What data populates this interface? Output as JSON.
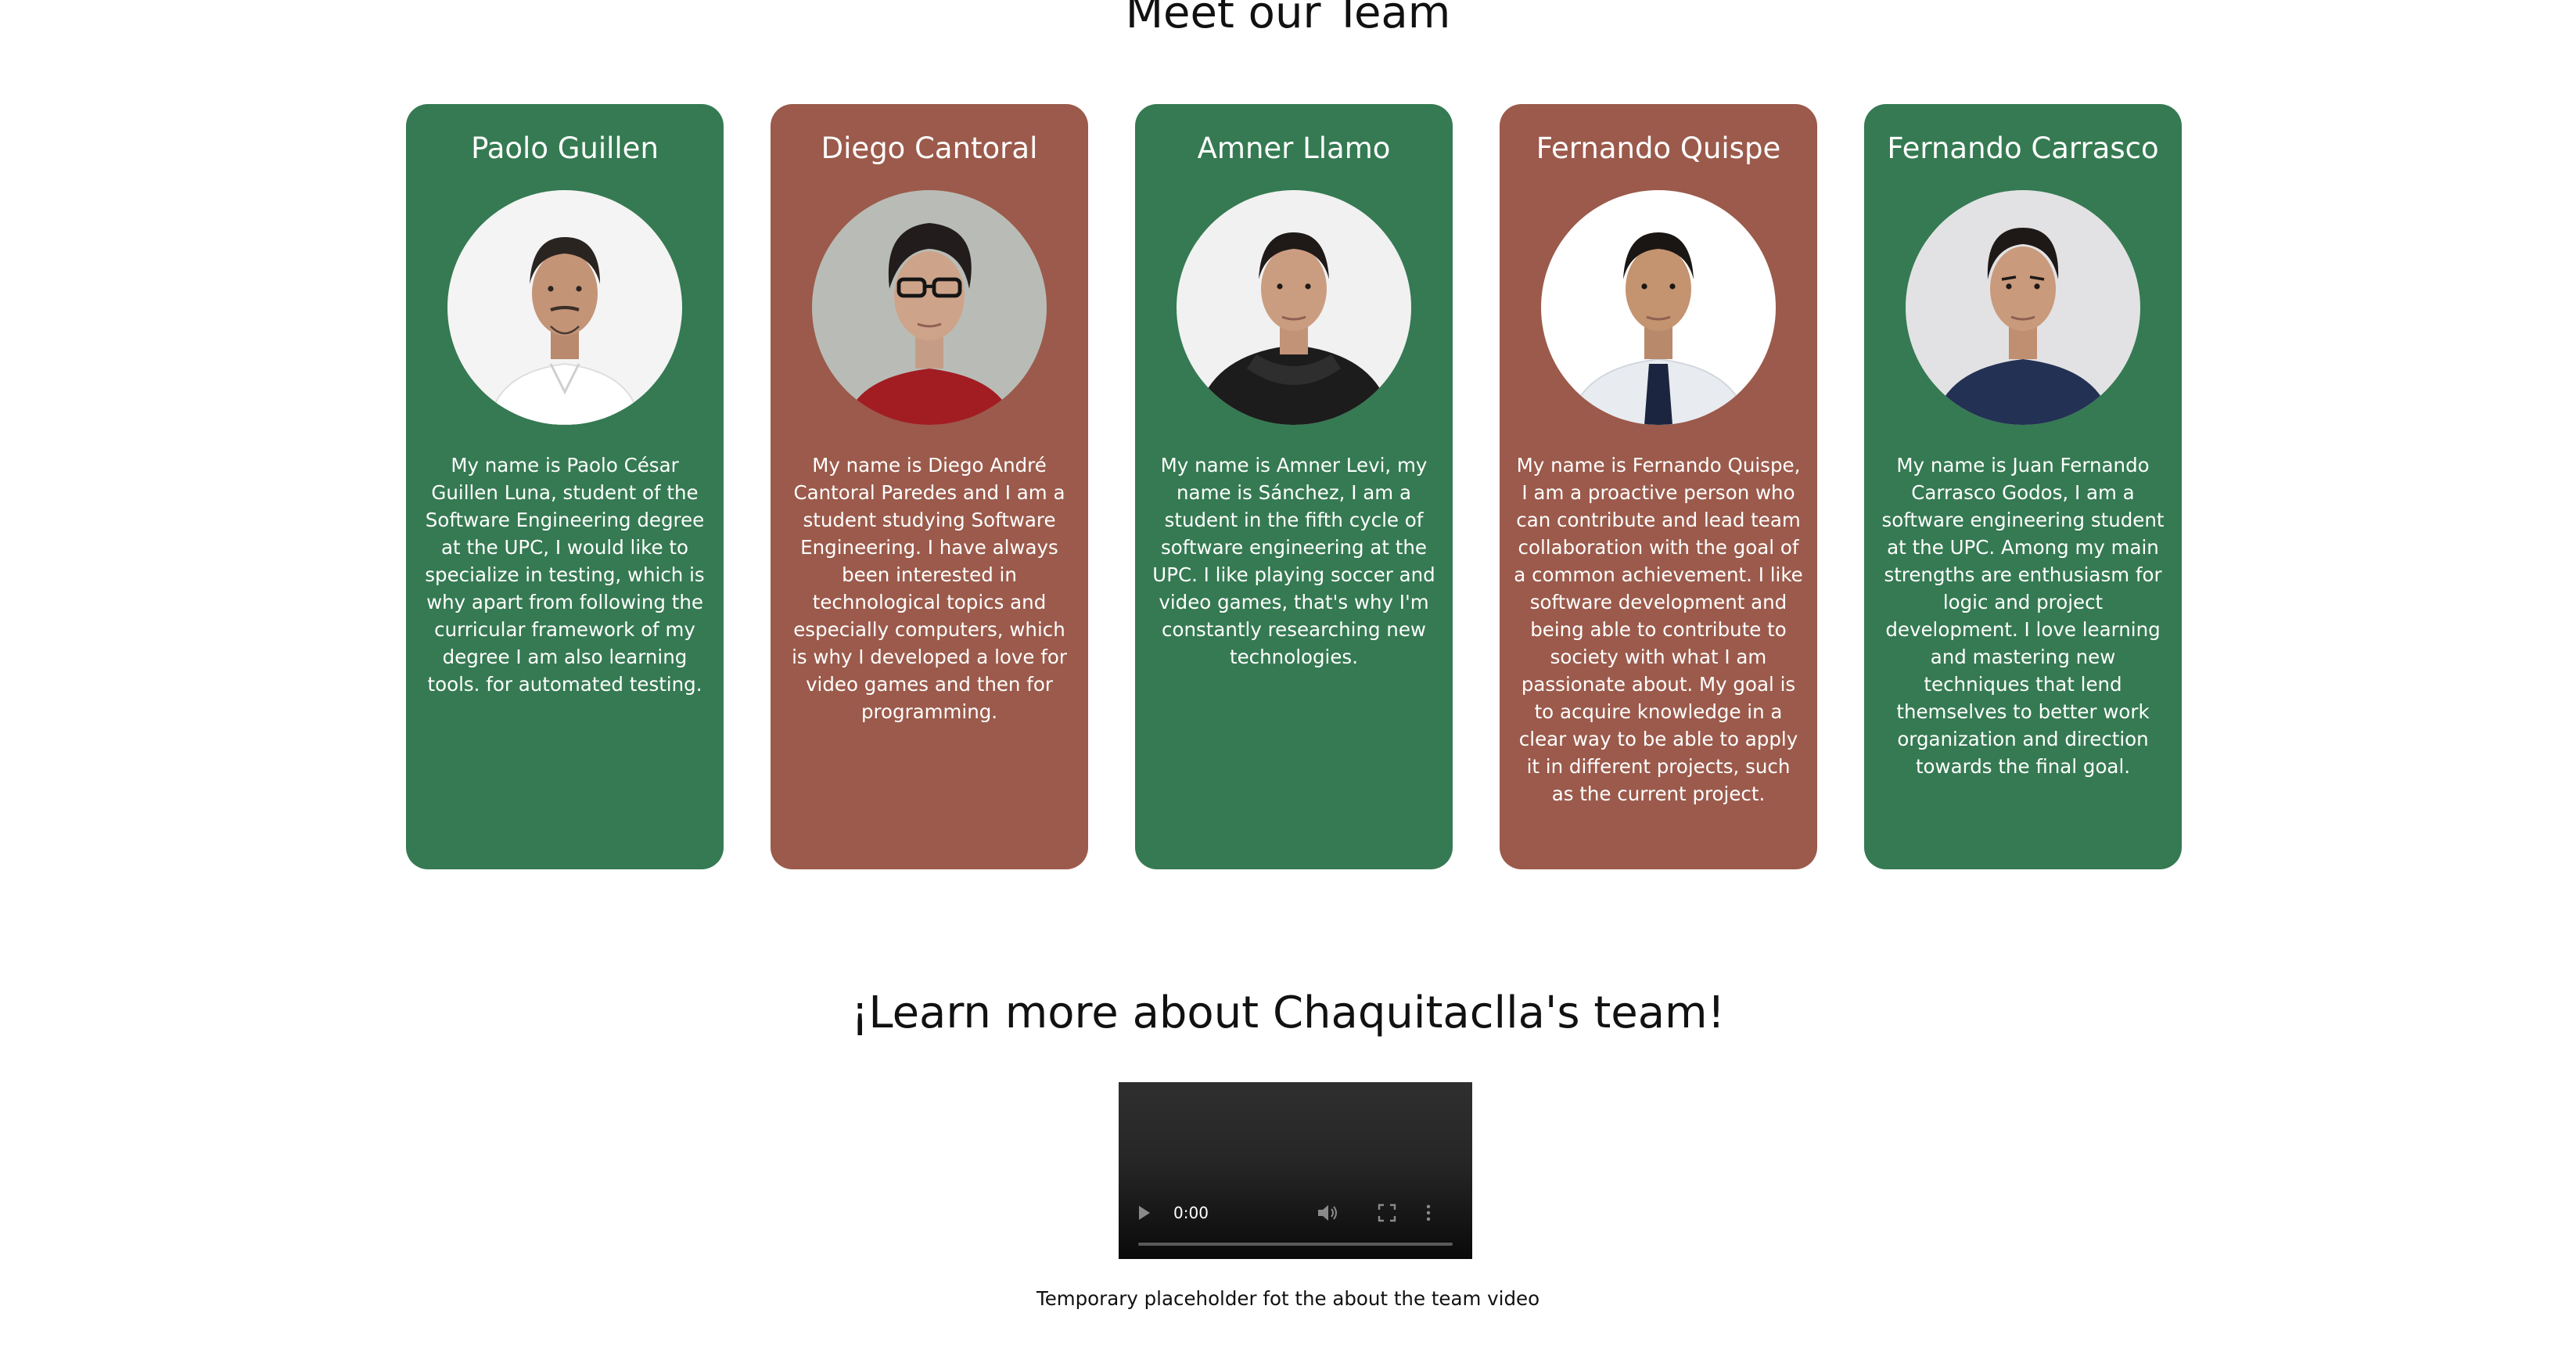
{
  "team_section": {
    "title": "Meet our Team"
  },
  "colors": {
    "green_card": "#357a52",
    "brown_card": "#9b5a4b"
  },
  "members": [
    {
      "name": "Paolo Guillen",
      "bio": "My name is Paolo César Guillen Luna, student of the Software Engineering degree at the UPC, I would like to specialize in testing, which is why apart from following the curricular framework of my degree I am also learning tools. for automated testing.",
      "card_color": "#357a52",
      "photo": "portrait-photo"
    },
    {
      "name": "Diego Cantoral",
      "bio": "My name is Diego André Cantoral Paredes and I am a student studying Software Engineering. I have always been interested in technological topics and especially computers, which is why I developed a love for video games and then for programming.",
      "card_color": "#9b5a4b",
      "photo": "portrait-photo"
    },
    {
      "name": "Amner Llamo",
      "bio": "My name is Amner Levi, my name is Sánchez, I am a student in the fifth cycle of software engineering at the UPC. I like playing soccer and video games, that's why I'm constantly researching new technologies.",
      "card_color": "#357a52",
      "photo": "portrait-photo"
    },
    {
      "name": "Fernando Quispe",
      "bio": "My name is Fernando Quispe, I am a proactive person who can contribute and lead team collaboration with the goal of a common achievement. I like software development and being able to contribute to society with what I am passionate about. My goal is to acquire knowledge in a clear way to be able to apply it in different projects, such as the current project.",
      "card_color": "#9b5a4b",
      "photo": "portrait-photo"
    },
    {
      "name": "Fernando Carrasco",
      "bio": "My name is Juan Fernando Carrasco Godos, I am a software engineering student at the UPC. Among my main strengths are enthusiasm for logic and project development. I love learning and mastering new techniques that lend themselves to better work organization and direction towards the final goal.",
      "card_color": "#357a52",
      "photo": "portrait-photo"
    }
  ],
  "video_section": {
    "title": "¡Learn more about Chaquitaclla's team!",
    "video": {
      "time": "0:00",
      "progress": 0,
      "icons": [
        "play-icon",
        "volume-icon",
        "fullscreen-icon",
        "more-options-icon"
      ]
    },
    "caption": "Temporary placeholder fot the about the team video"
  }
}
